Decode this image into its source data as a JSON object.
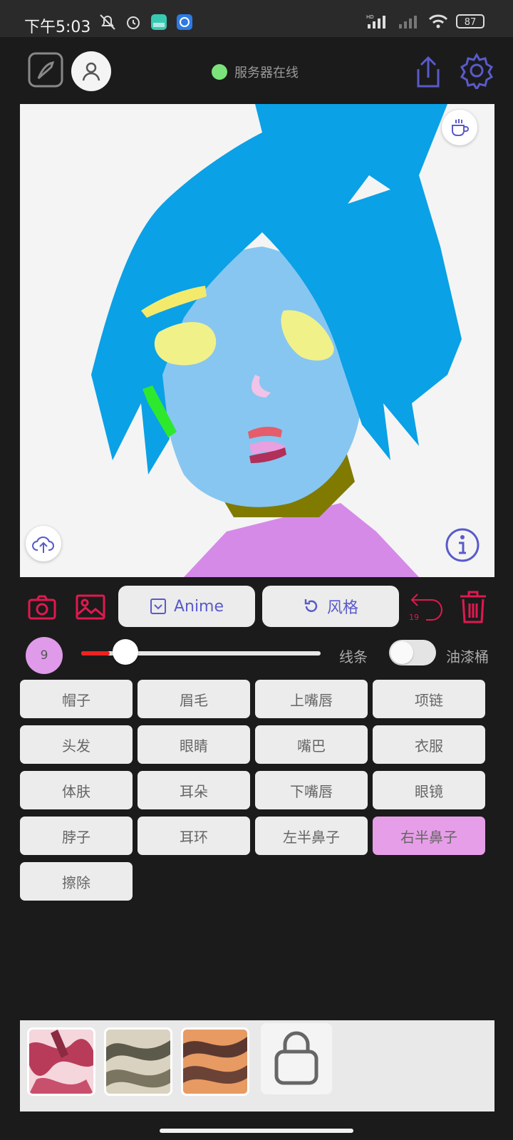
{
  "status_bar": {
    "time": "下午5:03",
    "battery": "87",
    "network_label": "HD"
  },
  "header": {
    "server_status": "服务器在线"
  },
  "toolbar": {
    "style_button": "Anime",
    "style_reset_button": "风格",
    "undo_count": "19"
  },
  "brush": {
    "size": "9",
    "size_fraction": 0.12,
    "line_label": "线条",
    "bucket_label": "油漆桶",
    "bucket_enabled": false
  },
  "parts": [
    "帽子",
    "眉毛",
    "上嘴唇",
    "项链",
    "头发",
    "眼睛",
    "嘴巴",
    "衣服",
    "体肤",
    "耳朵",
    "下嘴唇",
    "眼镜",
    "脖子",
    "耳环",
    "左半鼻子",
    "右半鼻子",
    "擦除"
  ],
  "active_part": "右半鼻子",
  "colors": {
    "accent": "#5a5acb",
    "danger": "#e0194f",
    "active_part": "#e79ee8",
    "server_online": "#7be27b"
  }
}
